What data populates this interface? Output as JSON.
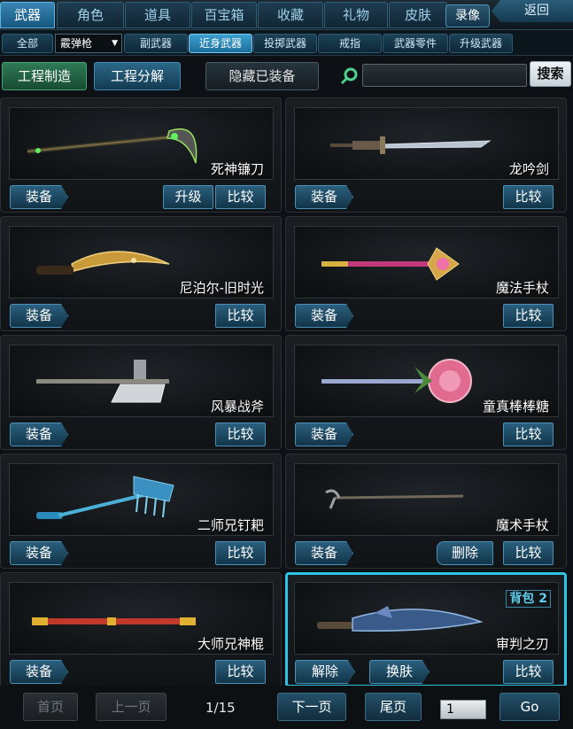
{
  "top_tabs": [
    {
      "label": "武器",
      "active": true
    },
    {
      "label": "角色"
    },
    {
      "label": "道具"
    },
    {
      "label": "百宝箱"
    },
    {
      "label": "收藏"
    },
    {
      "label": "礼物"
    },
    {
      "label": "皮肤"
    }
  ],
  "record_label": "录像",
  "back_label": "返回",
  "sub": {
    "all_label": "全部",
    "select_value": "霰弹枪",
    "tabs": [
      {
        "label": "副武器"
      },
      {
        "label": "近身武器",
        "active": true
      },
      {
        "label": "投掷武器"
      },
      {
        "label": "戒指"
      },
      {
        "label": "武器零件"
      },
      {
        "label": "升级武器"
      }
    ]
  },
  "actions": {
    "craft": "工程制造",
    "decompose": "工程分解",
    "hide_equipped": "隐藏已装备",
    "search_value": "",
    "search_button": "搜索"
  },
  "items": [
    {
      "name": "死神镰刀",
      "buttons": {
        "equip": "装备",
        "upgrade": "升级",
        "compare": "比较"
      }
    },
    {
      "name": "龙吟剑",
      "buttons": {
        "equip": "装备",
        "compare": "比较"
      }
    },
    {
      "name": "尼泊尔-旧时光",
      "buttons": {
        "equip": "装备",
        "compare": "比较"
      }
    },
    {
      "name": "魔法手杖",
      "buttons": {
        "equip": "装备",
        "compare": "比较"
      }
    },
    {
      "name": "风暴战斧",
      "buttons": {
        "equip": "装备",
        "compare": "比较"
      }
    },
    {
      "name": "童真棒棒糖",
      "buttons": {
        "equip": "装备",
        "compare": "比较"
      }
    },
    {
      "name": "二师兄钉耙",
      "buttons": {
        "equip": "装备",
        "compare": "比较"
      }
    },
    {
      "name": "魔术手杖",
      "buttons": {
        "equip": "装备",
        "delete": "删除",
        "compare": "比较"
      }
    },
    {
      "name": "大师兄神棍",
      "buttons": {
        "equip": "装备",
        "compare": "比较"
      }
    },
    {
      "name": "审判之刃",
      "tag": "背包 2",
      "selected": true,
      "buttons": {
        "unequip": "解除",
        "skin": "换肤",
        "compare": "比较"
      }
    }
  ],
  "pager": {
    "first": "首页",
    "prev": "上一页",
    "info": "1/15",
    "next": "下一页",
    "last": "尾页",
    "page_input": "1",
    "go": "Go"
  },
  "colors": {
    "accent": "#2fc3e6",
    "green": "#2f7a55",
    "blue": "#2b6888"
  }
}
